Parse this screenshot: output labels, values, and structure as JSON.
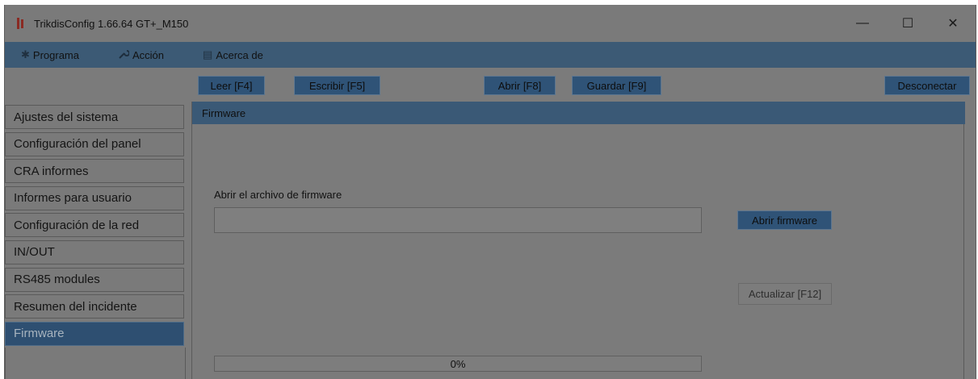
{
  "window": {
    "title": "TrikdisConfig 1.66.64   GT+_M150",
    "minimize_label": "—",
    "maximize_label": "☐",
    "close_label": "✕"
  },
  "menu": {
    "items": [
      {
        "label": "Programa",
        "icon": "gear-icon",
        "glyph": "✱"
      },
      {
        "label": "Acción",
        "icon": "wrench-icon",
        "glyph": "🔧"
      },
      {
        "label": "Acerca de",
        "icon": "info-icon",
        "glyph": "▤"
      }
    ]
  },
  "toolbar": {
    "read_label": "Leer [F4]",
    "write_label": "Escribir [F5]",
    "open_label": "Abrir [F8]",
    "save_label": "Guardar [F9]",
    "disconnect_label": "Desconectar"
  },
  "sidebar": {
    "items": [
      {
        "label": "Ajustes del sistema"
      },
      {
        "label": "Configuración del panel"
      },
      {
        "label": "CRA informes"
      },
      {
        "label": "Informes para usuario"
      },
      {
        "label": "Configuración de la red"
      },
      {
        "label": "IN/OUT"
      },
      {
        "label": "RS485 modules"
      },
      {
        "label": "Resumen del incidente"
      },
      {
        "label": "Firmware",
        "active": true
      }
    ]
  },
  "firmware": {
    "section_title": "Firmware",
    "file_label": "Abrir el archivo de firmware",
    "file_value": "",
    "open_button": "Abrir firmware",
    "update_button": "Actualizar [F12]",
    "progress_text": "0%",
    "progress_value": 0
  },
  "colors": {
    "accent": "#2f5377",
    "header": "#3a5976",
    "background": "#7b7b7b"
  }
}
